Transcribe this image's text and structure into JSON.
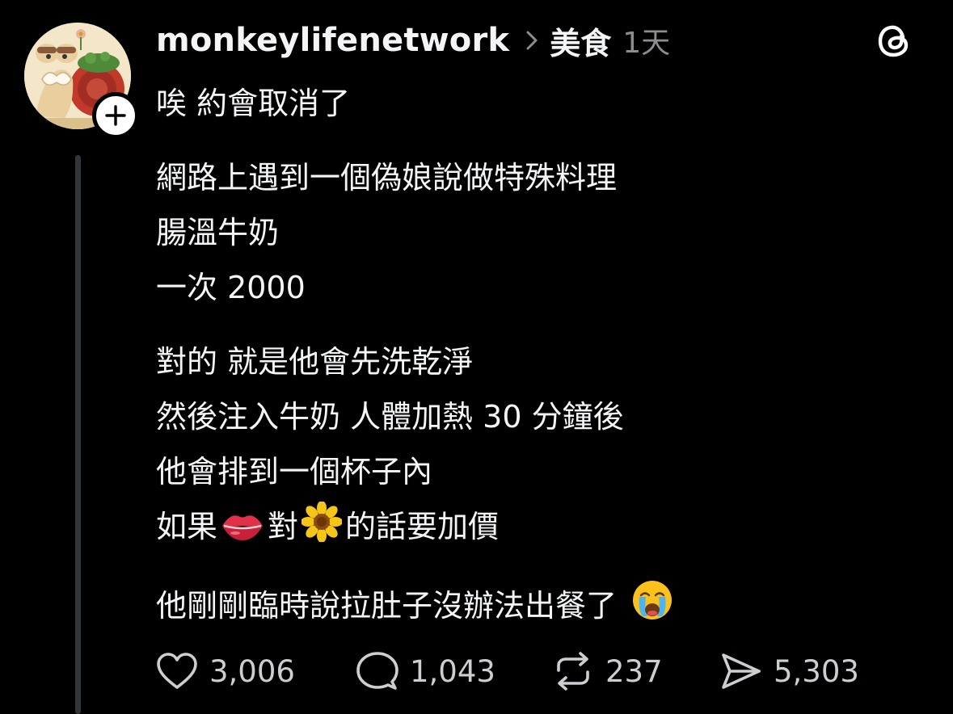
{
  "post": {
    "username": "monkeylifenetwork",
    "topic": "美食",
    "time": "1天",
    "title": "唉 約會取消了",
    "paragraphs": [
      {
        "lines": [
          "網路上遇到一個偽娘說做特殊料理",
          "腸溫牛奶",
          "一次 2000"
        ]
      },
      {
        "lines": [
          "對的 就是他會先洗乾淨",
          "然後注入牛奶 人體加熱 30 分鐘後",
          "他會排到一個杯子內"
        ]
      }
    ],
    "emoji_line": {
      "part1": "如果",
      "emoji1": "lips-emoji",
      "part2": "對",
      "emoji2": "sunflower-emoji",
      "part3": "的話要加價"
    },
    "last_line": {
      "text": "他剛剛臨時說拉肚子沒辦法出餐了",
      "emoji": "crying-face-emoji"
    },
    "actions": {
      "likes": "3,006",
      "replies": "1,043",
      "reposts": "237",
      "shares": "5,303"
    }
  },
  "icons": {
    "avatar": "snail-cartoon-avatar",
    "follow": "plus-icon",
    "chevron": "chevron-right-icon",
    "app": "threads-logo-icon",
    "like": "heart-icon",
    "reply": "comment-icon",
    "repost": "repost-icon",
    "share": "send-icon"
  },
  "colors": {
    "background": "#000000",
    "text": "#f3f5f7",
    "secondary": "#8b8d90",
    "thread_line": "#333638"
  }
}
